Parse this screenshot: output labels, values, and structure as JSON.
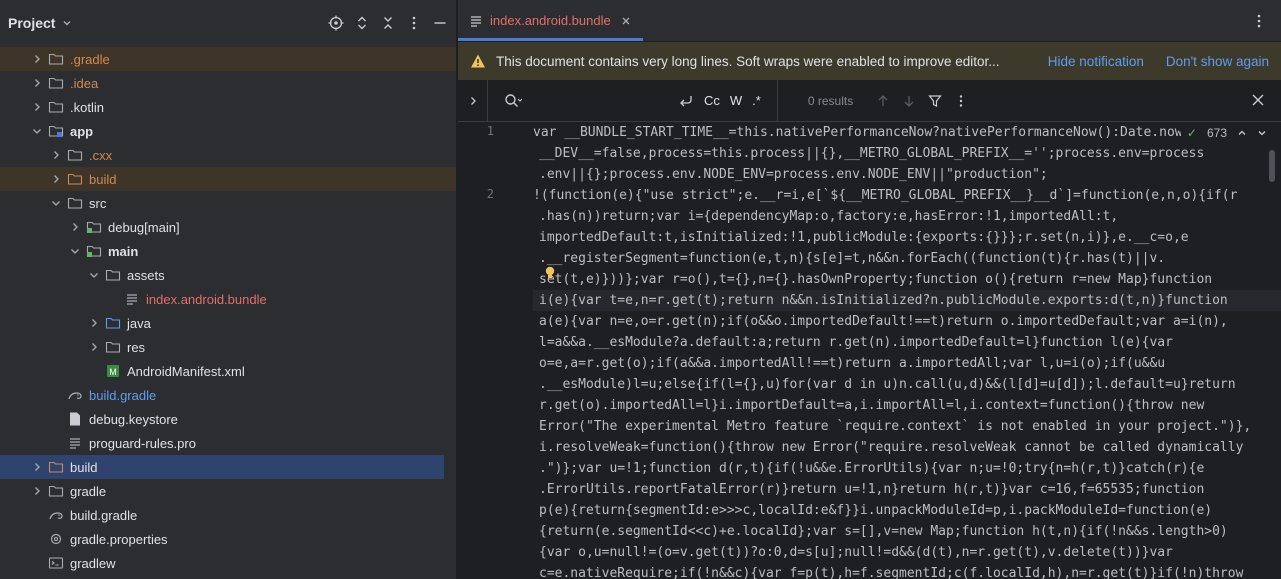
{
  "project_panel": {
    "title": "Project",
    "tree": [
      {
        "label": "gradle",
        "prefix": ".",
        "depth": 1,
        "expanded": false,
        "icon": "folder-icon",
        "color": "orange",
        "highlight": "orange"
      },
      {
        "label": "idea",
        "prefix": ".",
        "depth": 1,
        "expanded": false,
        "icon": "folder-icon",
        "color": "orange",
        "highlight": ""
      },
      {
        "label": "kotlin",
        "prefix": ".",
        "depth": 1,
        "expanded": false,
        "icon": "folder-icon",
        "color": "default",
        "highlight": ""
      },
      {
        "label": "app",
        "prefix": "",
        "depth": 1,
        "expanded": true,
        "icon": "module-folder-icon",
        "color": "bold",
        "highlight": ""
      },
      {
        "label": "cxx",
        "prefix": ".",
        "depth": 2,
        "expanded": false,
        "icon": "folder-icon",
        "color": "orange",
        "highlight": ""
      },
      {
        "label": "build",
        "prefix": "",
        "depth": 2,
        "expanded": false,
        "icon": "folder-orange-icon",
        "color": "orange",
        "highlight": "orange"
      },
      {
        "label": "src",
        "prefix": "",
        "depth": 2,
        "expanded": true,
        "icon": "folder-icon",
        "color": "default",
        "highlight": ""
      },
      {
        "label": "debug",
        "suffix": "[main]",
        "depth": 3,
        "expanded": false,
        "icon": "source-folder-icon",
        "color": "default",
        "highlight": ""
      },
      {
        "label": "main",
        "prefix": "",
        "depth": 3,
        "expanded": true,
        "icon": "source-folder-icon",
        "color": "bold",
        "highlight": ""
      },
      {
        "label": "assets",
        "prefix": "",
        "depth": 4,
        "expanded": true,
        "icon": "folder-icon",
        "color": "default",
        "highlight": ""
      },
      {
        "label": "index.android.bundle",
        "prefix": "",
        "depth": 5,
        "expanded": null,
        "icon": "text-file-icon",
        "color": "red",
        "highlight": ""
      },
      {
        "label": "java",
        "prefix": "",
        "depth": 4,
        "expanded": false,
        "icon": "blue-folder-icon",
        "color": "default",
        "highlight": ""
      },
      {
        "label": "res",
        "prefix": "",
        "depth": 4,
        "expanded": false,
        "icon": "folder-icon",
        "color": "default",
        "highlight": ""
      },
      {
        "label": "AndroidManifest.xml",
        "prefix": "",
        "depth": 4,
        "expanded": null,
        "icon": "manifest-icon",
        "color": "default",
        "highlight": ""
      },
      {
        "label": "build.gradle",
        "prefix": "",
        "depth": 2,
        "expanded": null,
        "icon": "gradle-icon",
        "color": "blue",
        "highlight": ""
      },
      {
        "label": "debug.keystore",
        "prefix": "",
        "depth": 2,
        "expanded": null,
        "icon": "file-icon",
        "color": "default",
        "highlight": ""
      },
      {
        "label": "proguard-rules.pro",
        "prefix": "",
        "depth": 2,
        "expanded": null,
        "icon": "text-file-icon",
        "color": "default",
        "highlight": ""
      },
      {
        "label": "build",
        "prefix": "",
        "depth": 1,
        "expanded": false,
        "icon": "folder-orange-icon",
        "color": "default",
        "highlight": "selected"
      },
      {
        "label": "gradle",
        "prefix": "",
        "depth": 1,
        "expanded": false,
        "icon": "folder-icon",
        "color": "default",
        "highlight": ""
      },
      {
        "label": "build.gradle",
        "prefix": "",
        "depth": 1,
        "expanded": null,
        "icon": "gradle-icon",
        "color": "default",
        "highlight": ""
      },
      {
        "label": "gradle.properties",
        "prefix": "",
        "depth": 1,
        "expanded": null,
        "icon": "settings-file-icon",
        "color": "default",
        "highlight": ""
      },
      {
        "label": "gradlew",
        "prefix": "",
        "depth": 1,
        "expanded": null,
        "icon": "terminal-file-icon",
        "color": "default",
        "highlight": ""
      }
    ]
  },
  "editor": {
    "tab_label": "index.android.bundle",
    "notification": {
      "text": "This document contains very long lines. Soft wraps were enabled to improve editor...",
      "hide_label": "Hide notification",
      "dont_show_label": "Don't show again"
    },
    "find": {
      "placeholder": "",
      "case_label": "Cc",
      "word_label": "W",
      "regex_label": ".*",
      "results": "0 results"
    },
    "inspection_count": "673",
    "line_numbers": [
      "1",
      "2"
    ],
    "lines": [
      {
        "num": "1",
        "text": "var __BUNDLE_START_TIME__=this.nativePerformanceNow?nativePerformanceNow():Date.now(",
        "wrapped": false
      },
      {
        "num": "",
        "text": "__DEV__=false,process=this.process||{},__METRO_GLOBAL_PREFIX__='';process.env=process",
        "wrapped": true,
        "mark": false
      },
      {
        "num": "",
        "text": ".env||{};process.env.NODE_ENV=process.env.NODE_ENV||\"production\";",
        "wrapped": true,
        "mark": false
      },
      {
        "num": "2",
        "text": "!(function(e){\"use strict\";e.__r=i,e[`${__METRO_GLOBAL_PREFIX__}__d`]=function(e,n,o){if(r",
        "wrapped": false
      },
      {
        "num": "",
        "text": ".has(n))return;var i={dependencyMap:o,factory:e,hasError:!1,importedAll:t,",
        "wrapped": true,
        "mark": true
      },
      {
        "num": "",
        "text": "importedDefault:t,isInitialized:!1,publicModule:{exports:{}}};r.set(n,i)},e.__c=o,e",
        "wrapped": true,
        "mark": true
      },
      {
        "num": "",
        "text": ".__registerSegment=function(e,t,n){s[e]=t,n&&n.forEach((function(t){r.has(t)||v.",
        "wrapped": true,
        "mark": true
      },
      {
        "num": "",
        "text": "set(t,e)}))};var r=o(),t={},n={}.hasOwnProperty;function o(){return r=new Map}function",
        "wrapped": true,
        "mark": true
      },
      {
        "num": "",
        "text": "i(e){var t=e,n=r.get(t);return n&&n.isInitialized?n.publicModule.exports:d(t,n)}function",
        "wrapped": true,
        "mark": true,
        "current": true
      },
      {
        "num": "",
        "text": "a(e){var n=e,o=r.get(n);if(o&&o.importedDefault!==t)return o.importedDefault;var a=i(n),",
        "wrapped": true,
        "mark": true
      },
      {
        "num": "",
        "text": "l=a&&a.__esModule?a.default:a;return r.get(n).importedDefault=l}function l(e){var",
        "wrapped": true,
        "mark": true
      },
      {
        "num": "",
        "text": "o=e,a=r.get(o);if(a&&a.importedAll!==t)return a.importedAll;var l,u=i(o);if(u&&u",
        "wrapped": true,
        "mark": true
      },
      {
        "num": "",
        "text": ".__esModule)l=u;else{if(l={},u)for(var d in u)n.call(u,d)&&(l[d]=u[d]);l.default=u}return",
        "wrapped": true,
        "mark": true
      },
      {
        "num": "",
        "text": "r.get(o).importedAll=l}i.importDefault=a,i.importAll=l,i.context=function(){throw new",
        "wrapped": true,
        "mark": true
      },
      {
        "num": "",
        "text": "Error(\"The experimental Metro feature `require.context` is not enabled in your project.\")},",
        "wrapped": true,
        "mark": true
      },
      {
        "num": "",
        "text": "i.resolveWeak=function(){throw new Error(\"require.resolveWeak cannot be called dynamically",
        "wrapped": true,
        "mark": true
      },
      {
        "num": "",
        "text": ".\")};var u=!1;function d(r,t){if(!u&&e.ErrorUtils){var n;u=!0;try{n=h(r,t)}catch(r){e",
        "wrapped": true,
        "mark": true
      },
      {
        "num": "",
        "text": ".ErrorUtils.reportFatalError(r)}return u=!1,n}return h(r,t)}var c=16,f=65535;function",
        "wrapped": true,
        "mark": true
      },
      {
        "num": "",
        "text": "p(e){return{segmentId:e>>>c,localId:e&f}}i.unpackModuleId=p,i.packModuleId=function(e)",
        "wrapped": true,
        "mark": true
      },
      {
        "num": "",
        "text": "{return(e.segmentId<<c)+e.localId};var s=[],v=new Map;function h(t,n){if(!n&&s.length>0)",
        "wrapped": true,
        "mark": true
      },
      {
        "num": "",
        "text": "{var o,u=null!=(o=v.get(t))?o:0,d=s[u];null!=d&&(d(t),n=r.get(t),v.delete(t))}var",
        "wrapped": true,
        "mark": true
      },
      {
        "num": "",
        "text": "c=e.nativeRequire;if(!n&&c){var f=p(t),h=f.segmentId;c(f.localId,h),n=r.get(t)}if(!n)throw",
        "wrapped": true,
        "mark": true
      }
    ]
  },
  "colors": {
    "background": "#1e1f22",
    "panel": "#2b2d30",
    "selection": "#2e436e",
    "accent": "#4a7bd8",
    "link": "#5f9cf0",
    "modified_file": "#e36e6a",
    "excluded_folder": "#d08a53"
  }
}
